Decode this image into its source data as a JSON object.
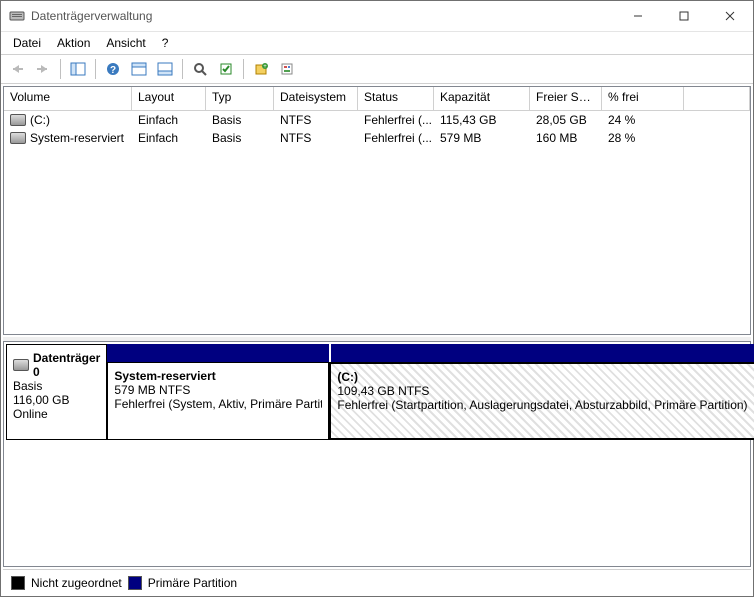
{
  "window": {
    "title": "Datenträgerverwaltung"
  },
  "menu": {
    "items": [
      "Datei",
      "Aktion",
      "Ansicht",
      "?"
    ]
  },
  "columns": [
    "Volume",
    "Layout",
    "Typ",
    "Dateisystem",
    "Status",
    "Kapazität",
    "Freier Sp...",
    "% frei"
  ],
  "volumes": [
    {
      "name": "(C:)",
      "layout": "Einfach",
      "type": "Basis",
      "fs": "NTFS",
      "status": "Fehlerfrei (...",
      "capacity": "115,43 GB",
      "free": "28,05 GB",
      "pct": "24 %"
    },
    {
      "name": "System-reserviert",
      "layout": "Einfach",
      "type": "Basis",
      "fs": "NTFS",
      "status": "Fehlerfrei (...",
      "capacity": "579 MB",
      "free": "160 MB",
      "pct": "28 %"
    }
  ],
  "disk": {
    "label": "Datenträger 0",
    "type": "Basis",
    "size": "116,00 GB",
    "state": "Online",
    "partitions": [
      {
        "name": "System-reserviert",
        "size": "579 MB NTFS",
        "status": "Fehlerfrei (System, Aktiv, Primäre Partition)",
        "selected": false
      },
      {
        "name": "(C:)",
        "size": "109,43 GB NTFS",
        "status": "Fehlerfrei (Startpartition, Auslagerungsdatei, Absturzabbild, Primäre Partition)",
        "selected": true
      }
    ]
  },
  "legend": {
    "unalloc": "Nicht zugeordnet",
    "primary": "Primäre Partition"
  }
}
